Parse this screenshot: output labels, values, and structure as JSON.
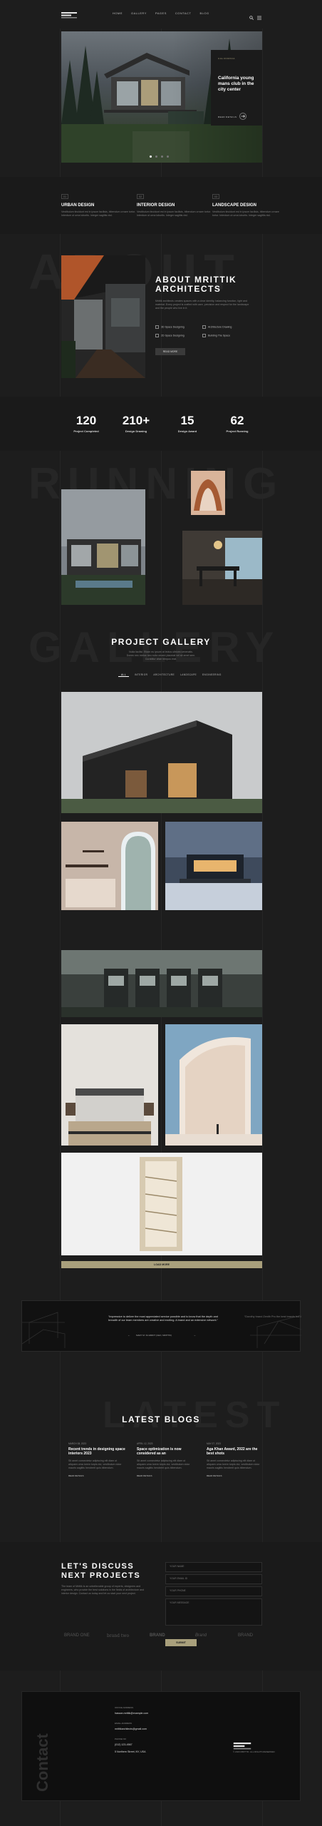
{
  "nav": {
    "logo_text": "MRITTIK",
    "items": [
      "HOME",
      "GALLERY",
      "PAGES",
      "CONTACT",
      "BLOG"
    ],
    "icons": [
      "search-icon",
      "menu-icon"
    ]
  },
  "hero": {
    "badge": "CALIFORNIA",
    "title": "California young mans club in the city center",
    "button": "READ DETAILS",
    "dots": 4
  },
  "services": [
    {
      "num": "01",
      "title": "URBAN DESIGN",
      "text": "Vestibulum tincidunt est in ipsum facilisis, bibendum ornare tortor. Interdum ut urna lobortis. Integer sagittis nisl."
    },
    {
      "num": "02",
      "title": "INTERIOR DESIGN",
      "text": "Vestibulum tincidunt est in ipsum facilisis, bibendum ornare tortor. Interdum ut urna lobortis. Integer sagittis nisl."
    },
    {
      "num": "03",
      "title": "LANDSCAPE DESIGN",
      "text": "Vestibulum tincidunt est in ipsum facilisis, bibendum ornare tortor. Interdum ut urna lobortis. Integer sagittis nisl."
    }
  ],
  "about": {
    "ghost": "ABOUT",
    "title_line1": "ABOUT MRITTIK",
    "title_line2": "ARCHITECTS",
    "text": "Mrittik architects creates spaces with a clear identity, balancing function, light and material. Every project is crafted with care, precision and respect for the landscape and the people who live in it.",
    "features": [
      "3D Space Designing",
      "Architecture Drawing",
      "2D Space Designing",
      "Building The Space"
    ],
    "button": "READ MORE"
  },
  "stats": [
    {
      "value": "120",
      "label": "Project Completed"
    },
    {
      "value": "210+",
      "label": "Design Drawing"
    },
    {
      "value": "15",
      "label": "Design Award"
    },
    {
      "value": "62",
      "label": "Project Running"
    }
  ],
  "running": {
    "ghost": "RUNNING"
  },
  "gallery": {
    "ghost": "GALLERY",
    "title": "PROJECT GALLERY",
    "text": "Nulla facilisi. Etiam eu ipsum at lectus ultrices venenatis. Donec nec metus nec nulla ornare placerat vel sit amet sem. Curabitur vitae tempus erat.",
    "filters": [
      "ALL",
      "INTERIOR",
      "ARCHITECTURE",
      "LANDSCAPE",
      "ENGINEERING"
    ],
    "load_more": "LOAD MORE"
  },
  "testimonial": {
    "quote": "“Impressive to deliver the most appreciated service possible and to know that the depth and breadth of our team members are creative and exciting. A brand and an extensive network.”",
    "quote_side": "“Dorothy brand Zenith Pro the best brands but our unmatched ex",
    "author": "MARY M. SCHMIDT (CEO, MRITTIK)"
  },
  "blogs": {
    "ghost": "LATEST",
    "title": "LATEST BLOGS",
    "posts": [
      {
        "date": "MARCH 08, 2023",
        "title": "Recent trends in designing space interiors 2023",
        "text": "Sit amet consectetur adipiscing elit diam ut aliquam urna lorem turpis dui, vestibulum dolor mauris sagittis hendrerit quis bibendum.",
        "link": "READ DETAILS"
      },
      {
        "date": "APRIL 12, 2023",
        "title": "Space optimization is now considered as an",
        "text": "Sit amet consectetur adipiscing elit diam ut aliquam urna lorem turpis dui, vestibulum dolor mauris sagittis hendrerit quis bibendum.",
        "link": "READ DETAILS"
      },
      {
        "date": "MAY 07, 2023",
        "title": "Aga Khan Award, 2022 are the best shots",
        "text": "Sit amet consectetur adipiscing elit diam ut aliquam urna lorem turpis dui, vestibulum dolor mauris sagittis hendrerit quis bibendum.",
        "link": "READ DETAILS"
      }
    ]
  },
  "discuss": {
    "title_line1": "LET'S DISCUSS",
    "title_line2": "NEXT PROJECTS",
    "text": "The team of Mrittik is an unbelievable group of experts, designers and engineers, who provide the best solutions in the fields of architecture and interior design. Contact us today and let us start your next project.",
    "fields": [
      "YOUR NAME",
      "YOUR EMAIL ID",
      "YOUR PHONE",
      "YOUR MESSAGE"
    ],
    "button": "SUBMIT"
  },
  "brands": [
    "BRAND ONE",
    "brand two",
    "BRAND",
    "Brand",
    "BRAND"
  ],
  "footer": {
    "vertical": "Contact",
    "address_label": "OFFICE ADDRESS",
    "address": "hassan.mrittik@example.com",
    "email_label": "EMAIL ADDRESS",
    "email": "mrittikarchitects@gmail.com",
    "phone_label": "PHONE NO",
    "phone": "(012) 123-4567",
    "location": "5 Northern Street, NY, USA",
    "logo_text": "MRITTIK",
    "copyright": "© 2023 MRITTIK. ALL RIGHTS RESERVED"
  },
  "colors": {
    "bg": "#1d1d1d",
    "accent": "#a9a07c",
    "text": "#ffffff"
  }
}
